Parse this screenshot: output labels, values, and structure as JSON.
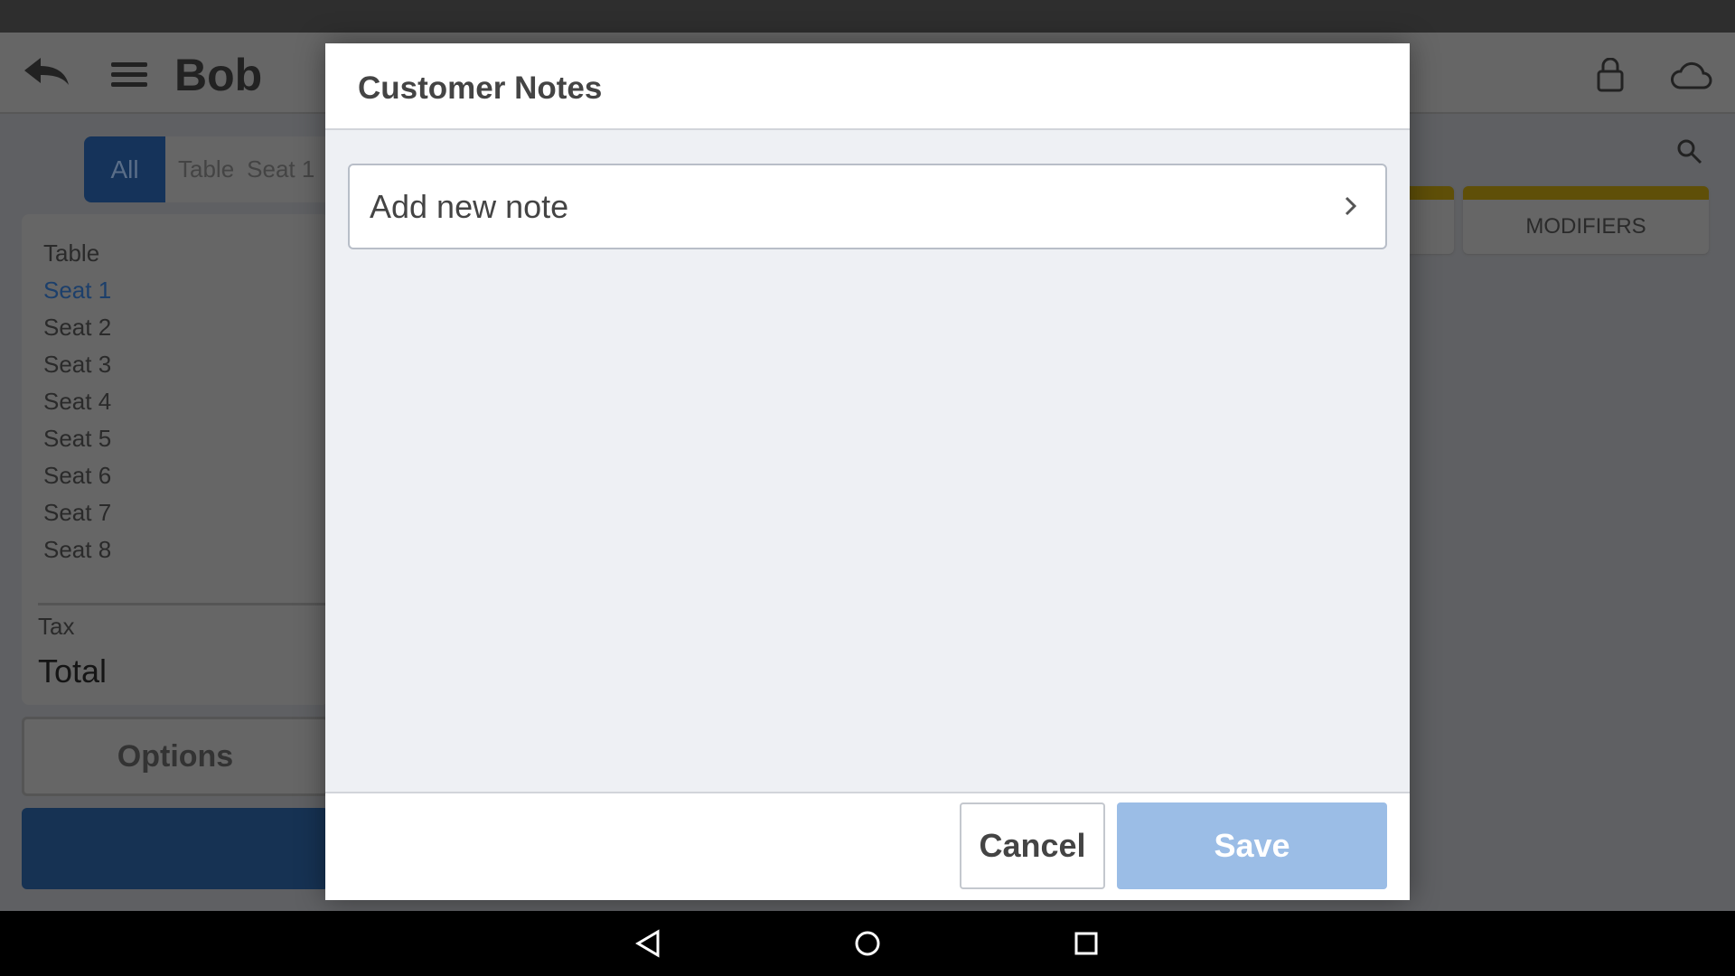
{
  "app_bar": {
    "title": "Bob",
    "icons": [
      "back-arrow-icon",
      "menu-icon",
      "lock-icon",
      "cloud-icon"
    ]
  },
  "tabs": {
    "items": [
      "All",
      "Table",
      "Seat 1"
    ],
    "selected": "All"
  },
  "seat_list": [
    "Table",
    "Seat 1",
    "Seat 2",
    "Seat 3",
    "Seat 4",
    "Seat 5",
    "Seat 6",
    "Seat 7",
    "Seat 8"
  ],
  "selected_seat": "Seat 1",
  "totals": {
    "tax_label": "Tax",
    "total_label": "Total"
  },
  "options_label": "Options",
  "categories": {
    "modifiers": "MODIFIERS"
  },
  "dialog": {
    "title": "Customer Notes",
    "add_note": "Add new note",
    "cancel": "Cancel",
    "save": "Save"
  },
  "colors": {
    "accent": "#15335a",
    "save": "#9bbde6",
    "category_stripe": "#c9a80f"
  }
}
